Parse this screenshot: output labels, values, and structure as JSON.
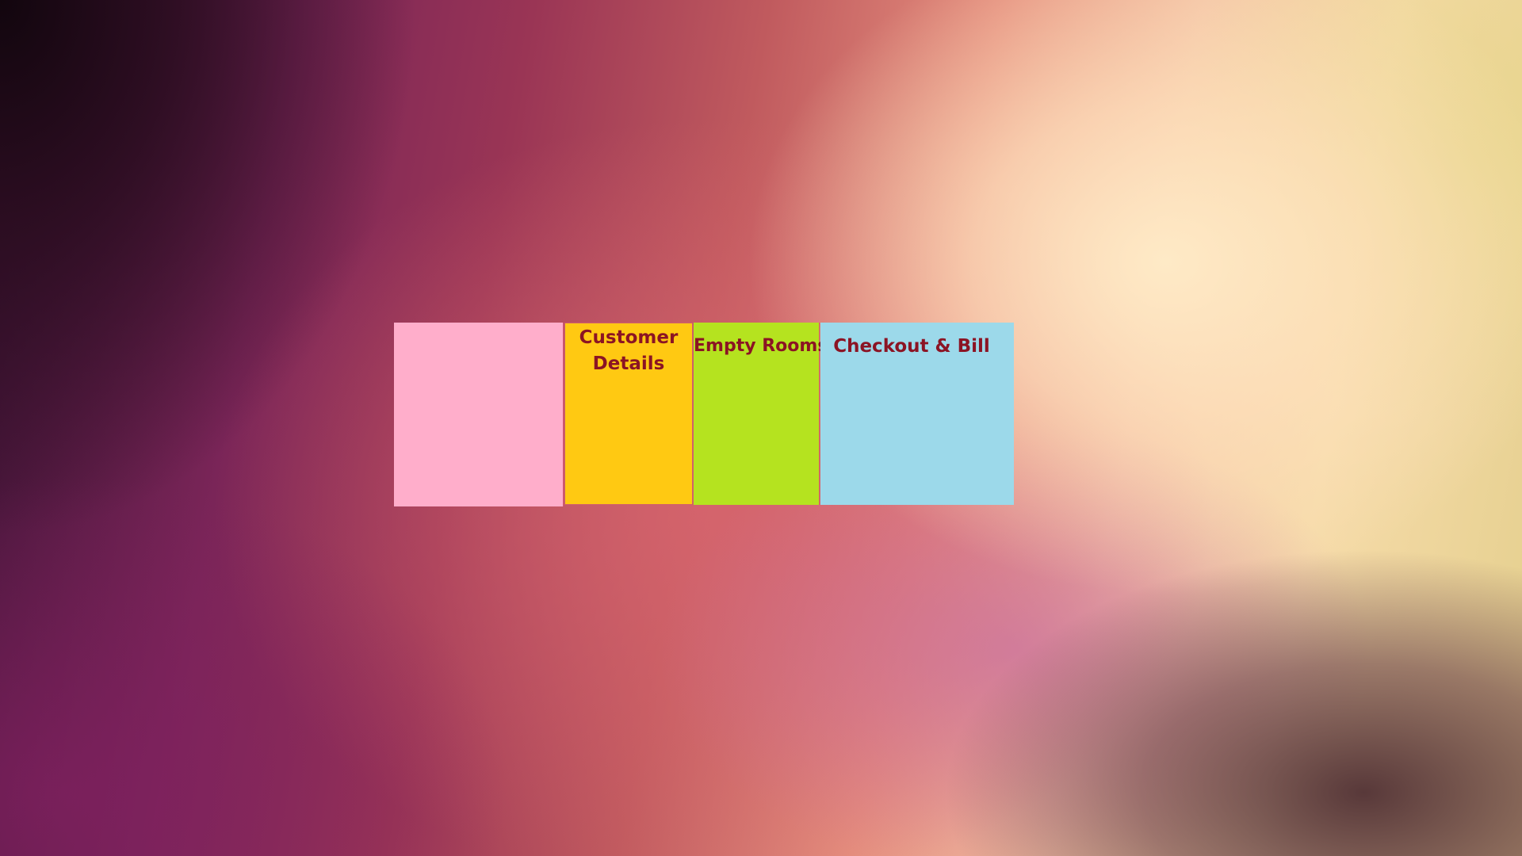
{
  "menu": {
    "tiles": [
      {
        "label": "",
        "color": "#ffaecb"
      },
      {
        "label": "Customer Details",
        "color": "#ffc912"
      },
      {
        "label": "Empty Rooms",
        "color": "#b5e31f"
      },
      {
        "label": "Checkout & Bill",
        "color": "#9cd9ea"
      }
    ],
    "text_color": "#8b1424"
  }
}
